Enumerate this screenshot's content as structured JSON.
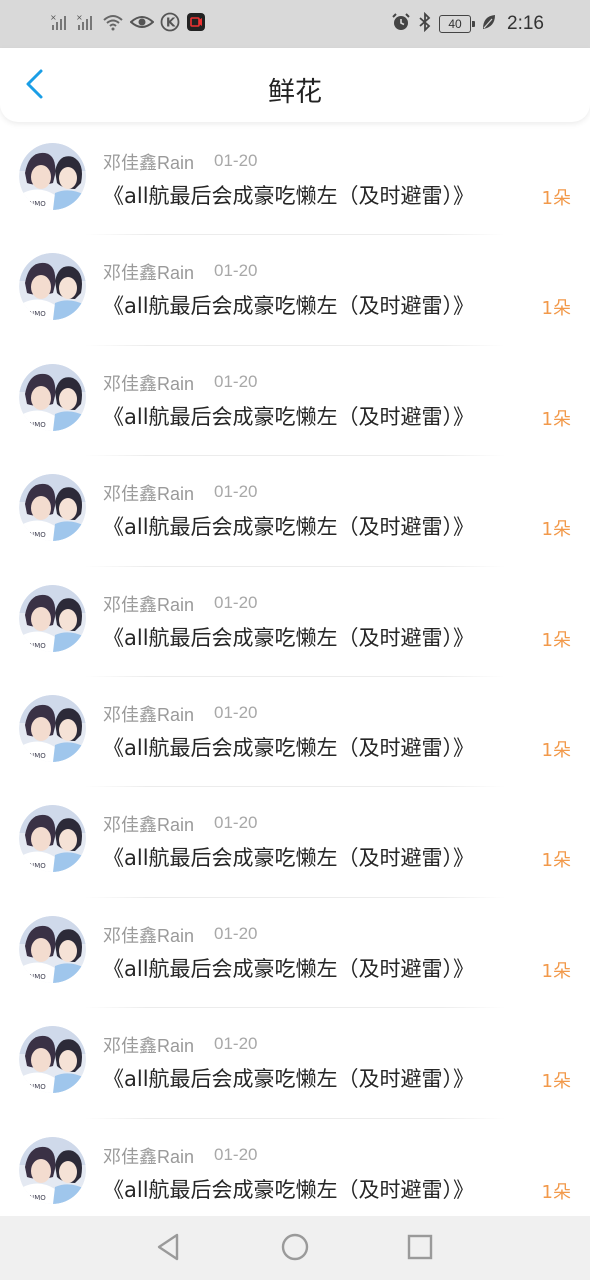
{
  "status_bar": {
    "time": "2:16",
    "battery": "40",
    "icons": [
      "signal-1-icon",
      "signal-2-icon",
      "wifi-icon",
      "eye-icon",
      "k-app-icon",
      "record-app-icon",
      "alarm-icon",
      "bluetooth-icon",
      "battery-icon",
      "leaf-icon"
    ]
  },
  "header": {
    "title": "鲜花",
    "back_icon": "chevron-left-icon"
  },
  "colors": {
    "accent_blue": "#1a9ee6",
    "count_orange": "#f2994a",
    "status_bar_bg": "#d9d9d9"
  },
  "items": [
    {
      "user": "邓佳鑫Rain",
      "date": "01-20",
      "title": "《all航最后会成豪吃懒左（及时避雷）》",
      "count": "1朵"
    },
    {
      "user": "邓佳鑫Rain",
      "date": "01-20",
      "title": "《all航最后会成豪吃懒左（及时避雷）》",
      "count": "1朵"
    },
    {
      "user": "邓佳鑫Rain",
      "date": "01-20",
      "title": "《all航最后会成豪吃懒左（及时避雷）》",
      "count": "1朵"
    },
    {
      "user": "邓佳鑫Rain",
      "date": "01-20",
      "title": "《all航最后会成豪吃懒左（及时避雷）》",
      "count": "1朵"
    },
    {
      "user": "邓佳鑫Rain",
      "date": "01-20",
      "title": "《all航最后会成豪吃懒左（及时避雷）》",
      "count": "1朵"
    },
    {
      "user": "邓佳鑫Rain",
      "date": "01-20",
      "title": "《all航最后会成豪吃懒左（及时避雷）》",
      "count": "1朵"
    },
    {
      "user": "邓佳鑫Rain",
      "date": "01-20",
      "title": "《all航最后会成豪吃懒左（及时避雷）》",
      "count": "1朵"
    },
    {
      "user": "邓佳鑫Rain",
      "date": "01-20",
      "title": "《all航最后会成豪吃懒左（及时避雷）》",
      "count": "1朵"
    },
    {
      "user": "邓佳鑫Rain",
      "date": "01-20",
      "title": "《all航最后会成豪吃懒左（及时避雷）》",
      "count": "1朵"
    },
    {
      "user": "邓佳鑫Rain",
      "date": "01-20",
      "title": "《all航最后会成豪吃懒左（及时避雷）》",
      "count": "1朵"
    }
  ],
  "nav_bar": {
    "buttons": [
      "back-triangle-icon",
      "home-circle-icon",
      "recent-square-icon"
    ]
  }
}
